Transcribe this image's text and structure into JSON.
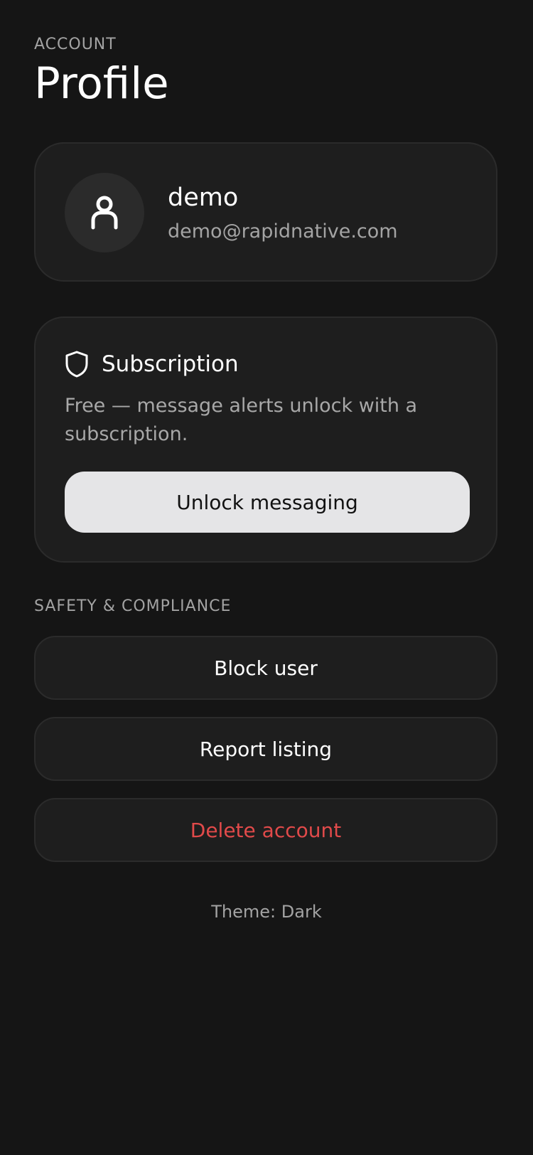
{
  "header": {
    "eyebrow": "ACCOUNT",
    "title": "Profile"
  },
  "profile": {
    "avatar_icon": "user-icon",
    "name": "demo",
    "email": "demo@rapidnative.com"
  },
  "subscription": {
    "icon": "shield-icon",
    "title": "Subscription",
    "description": "Free — message alerts unlock with a subscription.",
    "button_label": "Unlock messaging"
  },
  "safety": {
    "label": "SAFETY & COMPLIANCE",
    "actions": [
      {
        "label": "Block user"
      },
      {
        "label": "Report listing"
      },
      {
        "label": "Delete account"
      }
    ]
  },
  "footer": {
    "theme": "Theme: Dark"
  },
  "colors": {
    "background": "#151515",
    "card": "#1E1E1E",
    "border": "#2B2B2B",
    "primary_button": "#E5E5E7",
    "danger": "#E14A4A"
  }
}
